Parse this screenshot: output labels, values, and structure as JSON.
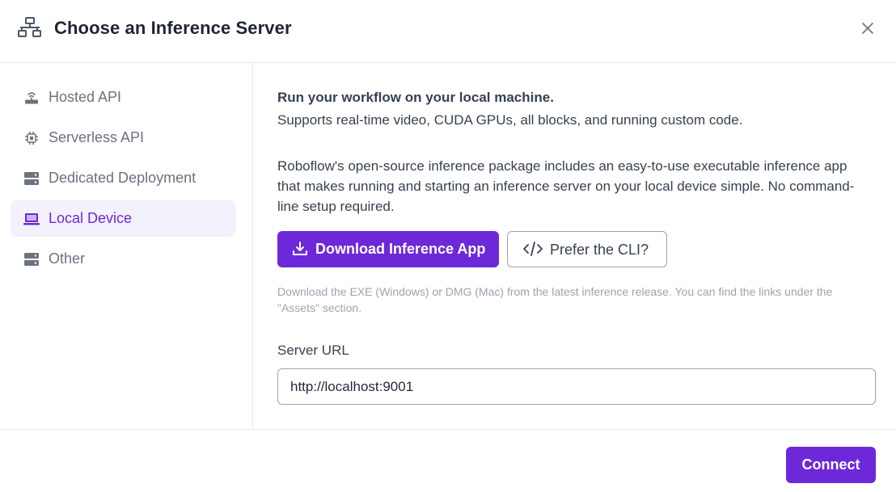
{
  "dialog": {
    "title": "Choose an Inference Server",
    "title_icon": "network-icon",
    "close_icon": "close-icon"
  },
  "sidebar": {
    "items": [
      {
        "label": "Hosted API",
        "icon": "router-icon",
        "active": false
      },
      {
        "label": "Serverless API",
        "icon": "cpu-chip-icon",
        "active": false
      },
      {
        "label": "Dedicated Deployment",
        "icon": "server-icon",
        "active": false
      },
      {
        "label": "Local Device",
        "icon": "laptop-icon",
        "active": true
      },
      {
        "label": "Other",
        "icon": "server-icon",
        "active": false
      }
    ]
  },
  "main": {
    "heading": "Run your workflow on your local machine.",
    "subline": "Supports real-time video, CUDA GPUs, all blocks, and running custom code.",
    "description": "Roboflow's open-source inference package includes an easy-to-use executable inference app that makes running and starting an inference server on your local device simple. No command-line setup required.",
    "download_button": "Download Inference App",
    "download_icon": "download-icon",
    "cli_button": "Prefer the CLI?",
    "cli_icon": "code-icon",
    "hint": "Download the EXE (Windows) or DMG (Mac) from the latest inference release. You can find the links under the \"Assets\" section.",
    "server_url_label": "Server URL",
    "server_url_value": "http://localhost:9001"
  },
  "footer": {
    "connect_button": "Connect"
  },
  "colors": {
    "accent": "#6d28d9",
    "active_bg": "#f3f1fb",
    "muted_text": "#6b7280",
    "hint_text": "#9ca3af",
    "border": "#e5e7eb"
  }
}
